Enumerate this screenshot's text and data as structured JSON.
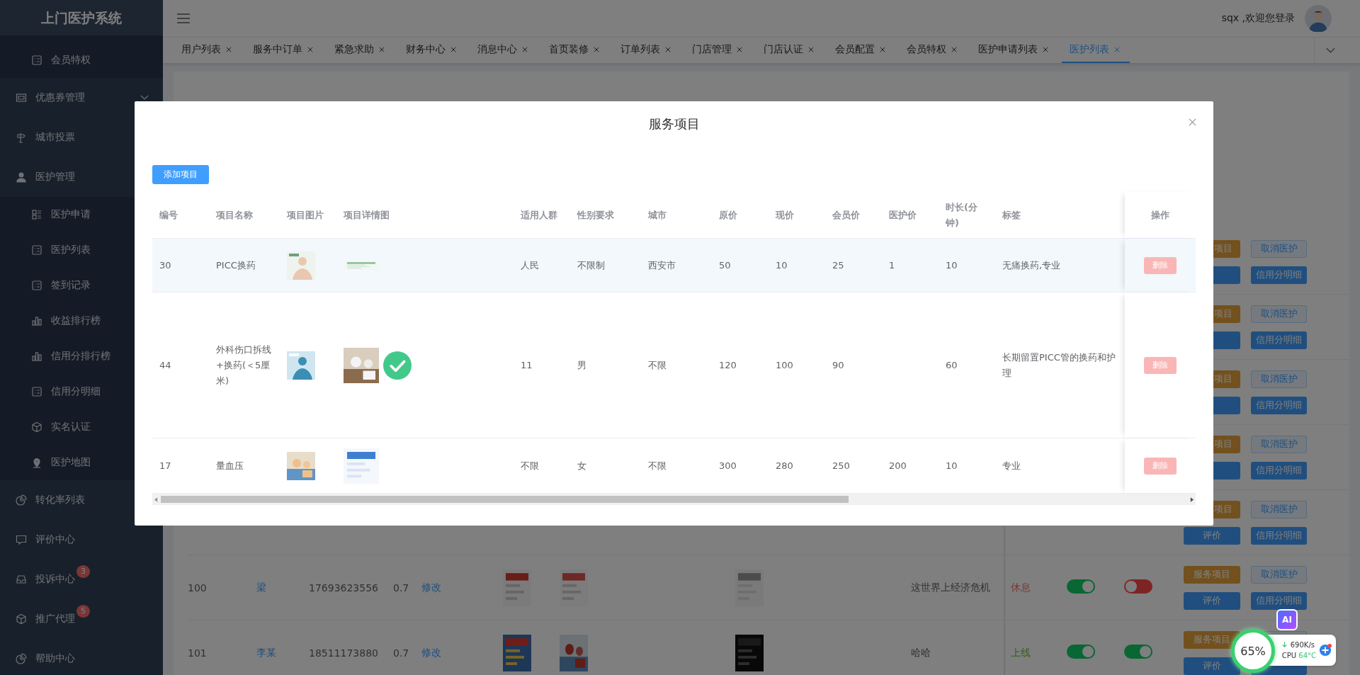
{
  "sidebar": {
    "title": "上门医护系统",
    "items": [
      {
        "label": "会员特权",
        "kind": "sub"
      },
      {
        "label": "优惠券管理",
        "kind": "item",
        "expanded": false
      },
      {
        "label": "城市投票",
        "kind": "item"
      },
      {
        "label": "医护管理",
        "kind": "item",
        "children": [
          {
            "label": "医护申请"
          },
          {
            "label": "医护列表"
          },
          {
            "label": "签到记录"
          },
          {
            "label": "收益排行榜"
          },
          {
            "label": "信用分排行榜"
          },
          {
            "label": "信用分明细"
          },
          {
            "label": "实名认证"
          },
          {
            "label": "医护地图"
          }
        ]
      },
      {
        "label": "转化率列表",
        "kind": "item"
      },
      {
        "label": "评价中心",
        "kind": "item"
      },
      {
        "label": "投诉中心",
        "kind": "item",
        "badge": "3"
      },
      {
        "label": "推广代理",
        "kind": "item",
        "badge": "5"
      },
      {
        "label": "帮助中心",
        "kind": "item"
      }
    ]
  },
  "header": {
    "greeting": "sqx ,欢迎您登录"
  },
  "tabs": [
    {
      "label": "用户列表",
      "selected": false
    },
    {
      "label": "服务中订单",
      "selected": false
    },
    {
      "label": "紧急求助",
      "selected": false
    },
    {
      "label": "财务中心",
      "selected": false
    },
    {
      "label": "消息中心",
      "selected": false
    },
    {
      "label": "首页装修",
      "selected": false
    },
    {
      "label": "订单列表",
      "selected": false
    },
    {
      "label": "门店管理",
      "selected": false
    },
    {
      "label": "门店认证",
      "selected": false
    },
    {
      "label": "会员配置",
      "selected": false
    },
    {
      "label": "会员特权",
      "selected": false
    },
    {
      "label": "医护申请列表",
      "selected": false
    },
    {
      "label": "医护列表",
      "selected": true
    }
  ],
  "list_rows": [
    {
      "kind": "actions",
      "actions": {
        "service": "项目",
        "cancel": "取消医护",
        "credit": "信用分明细"
      }
    },
    {
      "kind": "actions",
      "actions": {
        "service": "项目",
        "cancel": "取消医护",
        "credit": "信用分明细"
      }
    },
    {
      "kind": "actions",
      "actions": {
        "service": "项目",
        "cancel": "取消医护",
        "credit": "信用分明细"
      }
    },
    {
      "kind": "actions",
      "actions": {
        "service": "项目",
        "cancel": "取消医护",
        "credit": "信用分明细"
      }
    },
    {
      "kind": "actions",
      "actions": {
        "service": "项目",
        "cancel": "取消医护",
        "review": "评价",
        "credit": "信用分明细"
      }
    },
    {
      "kind": "full",
      "id": "100",
      "name": "梁",
      "phone": "17693623556",
      "rate": "0.7",
      "edit": "修改",
      "review": "这世界上经济危机",
      "status": "休息",
      "online": false,
      "switch_a": true,
      "switch_b": false,
      "actions": {
        "service": "服务项目",
        "cancel": "取消医护",
        "review": "评价",
        "credit": "信用分明细"
      }
    },
    {
      "kind": "full",
      "id": "101",
      "name": "李某",
      "phone": "18511173880",
      "rate": "0.7",
      "edit": "修改",
      "review": "哈哈",
      "status": "上线",
      "online": true,
      "switch_a": true,
      "switch_b": true,
      "actions": {
        "service": "服务项目",
        "review": "评价"
      }
    }
  ],
  "dialog": {
    "title": "服务项目",
    "add_button": "添加项目",
    "columns": [
      "编号",
      "项目名称",
      "项目图片",
      "项目详情图",
      "适用人群",
      "性别要求",
      "城市",
      "原价",
      "现价",
      "会员价",
      "医护价",
      "时长(分钟)",
      "标签",
      "操作"
    ],
    "rows": [
      {
        "highlighted": true,
        "id": "30",
        "name": "PICC换药",
        "audience": "人民",
        "gender": "不限制",
        "city": "西安市",
        "price_original": "50",
        "price_now": "10",
        "price_member": "25",
        "price_nurse": "1",
        "duration": "10",
        "tags": "无痛换药,专业",
        "detail_checked": false,
        "delete": {
          "label": "删除",
          "disabled": true
        }
      },
      {
        "highlighted": false,
        "id": "44",
        "name": "外科伤口拆线+换药(＜5厘米)",
        "audience": "11",
        "gender": "男",
        "city": "不限",
        "price_original": "120",
        "price_now": "100",
        "price_member": "90",
        "duration": "60",
        "tags": "长期留置PICC管的换药和护理",
        "detail_checked": true,
        "delete": {
          "label": "删除",
          "disabled": true
        }
      },
      {
        "highlighted": false,
        "id": "17",
        "name": "量血压",
        "audience": "不限",
        "gender": "女",
        "city": "不限",
        "price_original": "300",
        "price_now": "280",
        "price_member": "250",
        "price_nurse": "200",
        "duration": "10",
        "tags": "专业",
        "detail_checked": false,
        "delete": {
          "label": "删除",
          "disabled": true
        }
      }
    ]
  },
  "widget": {
    "percent": "65%",
    "net_speed": "690K/s",
    "cpu_label": "CPU",
    "cpu_temp": "64°C",
    "ai": "AI"
  }
}
